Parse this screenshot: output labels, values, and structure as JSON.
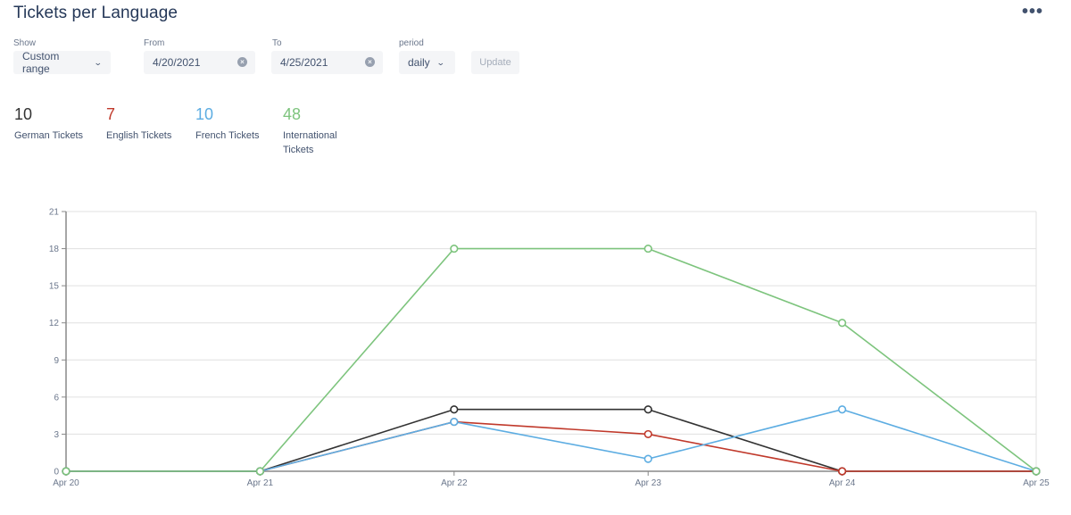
{
  "header": {
    "title": "Tickets per Language",
    "more_icon": "ellipsis-icon",
    "more_glyph": "•••"
  },
  "controls": {
    "show": {
      "label": "Show",
      "value": "Custom range",
      "icon": "chevron-down-icon",
      "chevron": "⌄"
    },
    "from": {
      "label": "From",
      "value": "4/20/2021",
      "clear_icon": "clear-icon",
      "clear_glyph": "×"
    },
    "to": {
      "label": "To",
      "value": "4/25/2021",
      "clear_icon": "clear-icon",
      "clear_glyph": "×"
    },
    "period": {
      "label": "period",
      "value": "daily",
      "icon": "chevron-down-icon",
      "chevron": "⌄"
    },
    "update_label": "Update"
  },
  "stats": [
    {
      "value": "10",
      "label": "German Tickets",
      "color": "#333333"
    },
    {
      "value": "7",
      "label": "English Tickets",
      "color": "#c0392b"
    },
    {
      "value": "10",
      "label": "French Tickets",
      "color": "#5dade2"
    },
    {
      "value": "48",
      "label": "International Tickets",
      "color": "#7dc47d"
    }
  ],
  "chart_data": {
    "type": "line",
    "title": "",
    "xlabel": "",
    "ylabel": "",
    "categories": [
      "Apr 20",
      "Apr 21",
      "Apr 22",
      "Apr 23",
      "Apr 24",
      "Apr 25"
    ],
    "yticks": [
      0,
      3,
      6,
      9,
      12,
      15,
      18,
      21
    ],
    "ylim": [
      0,
      21
    ],
    "grid": true,
    "legend": "none",
    "series": [
      {
        "name": "German Tickets",
        "color": "#333333",
        "values": [
          0,
          0,
          5,
          5,
          0,
          0
        ]
      },
      {
        "name": "English Tickets",
        "color": "#c0392b",
        "values": [
          0,
          0,
          4,
          3,
          0,
          0
        ]
      },
      {
        "name": "French Tickets",
        "color": "#5dade2",
        "values": [
          0,
          0,
          4,
          1,
          5,
          0
        ]
      },
      {
        "name": "International Tickets",
        "color": "#7dc47d",
        "values": [
          0,
          0,
          18,
          18,
          12,
          0
        ]
      }
    ]
  }
}
